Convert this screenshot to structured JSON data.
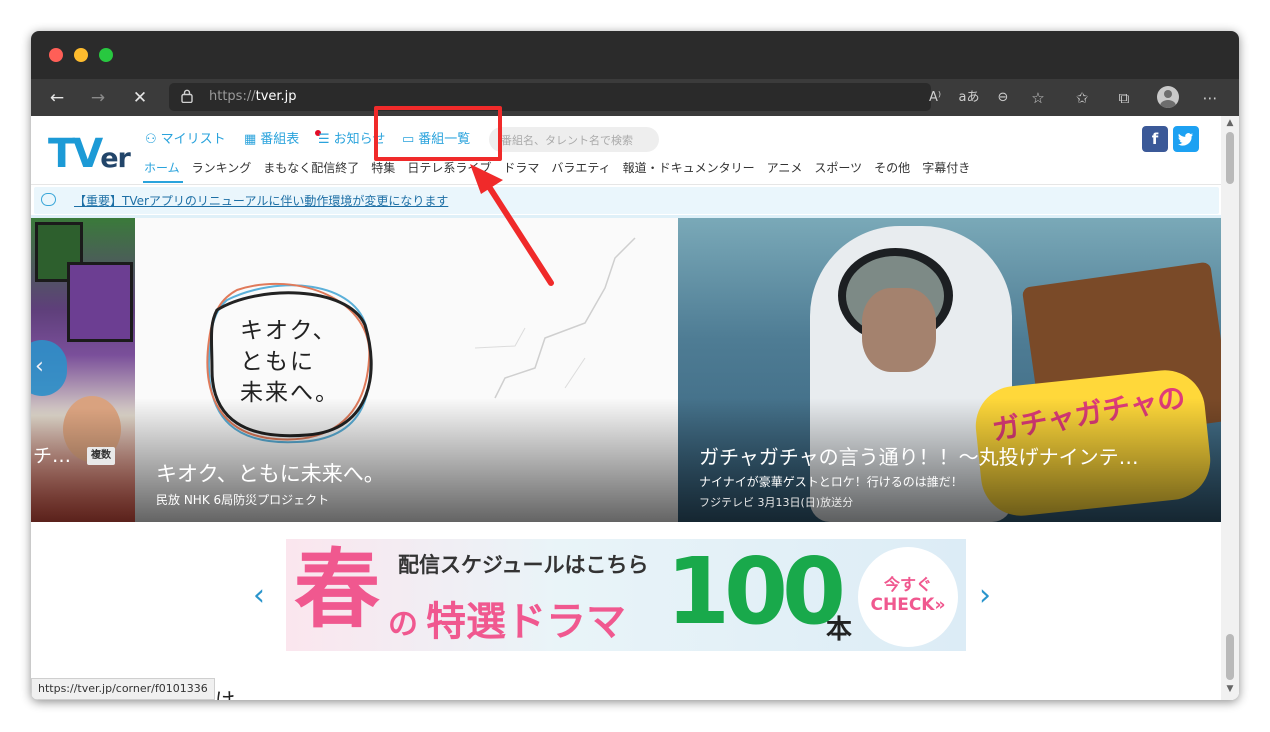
{
  "browser": {
    "url_scheme": "https://",
    "url_host": "tver.jp",
    "icons": [
      "back-icon",
      "forward-icon",
      "stop-icon",
      "lock-icon",
      "read-aloud-icon",
      "translate-icon",
      "zoom-out-icon",
      "favorite-add-icon",
      "favorites-icon",
      "collections-icon",
      "profile-icon",
      "more-icon"
    ],
    "read_aloud": "A⁾",
    "translate": "aあ"
  },
  "header": {
    "logo_main": "TV",
    "logo_sub": "er",
    "top_nav": [
      {
        "label": "マイリスト",
        "icon": "person-icon"
      },
      {
        "label": "番組表",
        "icon": "grid-icon"
      },
      {
        "label": "お知らせ",
        "icon": "list-icon"
      },
      {
        "label": "番組一覧",
        "icon": "tv-icon"
      }
    ],
    "search_placeholder": "番組名、タレント名で検索",
    "facebook": "f",
    "twitter": "t",
    "categories": [
      "ホーム",
      "ランキング",
      "まもなく配信終了",
      "特集",
      "日テレ系ライブ",
      "ドラマ",
      "バラエティ",
      "報道・ドキュメンタリー",
      "アニメ",
      "スポーツ",
      "その他",
      "字幕付き"
    ]
  },
  "notice": {
    "text": "【重要】TVerアプリのリニューアルに伴い動作環境が変更になります"
  },
  "slides": {
    "left": {
      "title": "チ…",
      "badge": "複数"
    },
    "center": {
      "art_text": [
        "キオク、",
        "ともに",
        "未来へ。"
      ],
      "title": "キオク、ともに未来へ。",
      "subtitle": "民放 NHK 6局防災プロジェクト"
    },
    "right": {
      "art_text": "ガチャガチャの",
      "title": "ガチャガチャの言う通り！！～丸投げナインテ…",
      "subtitle": "ナイナイが豪華ゲストとロケ！行けるのは誰だ！",
      "meta": "フジテレビ 3月13日(日)放送分"
    }
  },
  "banner": {
    "schedule": "配信スケジュールはこちら",
    "spring": "春",
    "no": "の",
    "drama": "特選ドラマ",
    "count": "100",
    "unit": "本",
    "cta_top": "今すぐ",
    "cta_bottom": "CHECK»"
  },
  "section_title": "まけ",
  "status_bar": "https://tver.jp/corner/f0101336",
  "colors": {
    "accent": "#2aa3dc",
    "highlight": "#f02a2a",
    "green": "#19a94b",
    "pink": "#f0588f"
  }
}
